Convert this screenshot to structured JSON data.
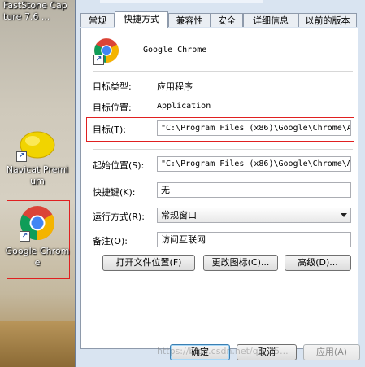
{
  "desktop": {
    "icons": [
      {
        "label": "FastStone Capture 7.6 ..."
      },
      {
        "label": "Navicat Premium"
      },
      {
        "label": "Google Chrome"
      }
    ]
  },
  "dialog": {
    "tabs": [
      {
        "label": "常规"
      },
      {
        "label": "快捷方式"
      },
      {
        "label": "兼容性"
      },
      {
        "label": "安全"
      },
      {
        "label": "详细信息"
      },
      {
        "label": "以前的版本"
      }
    ],
    "app_name": "Google Chrome",
    "target_type_label": "目标类型:",
    "target_type_value": "应用程序",
    "target_location_label": "目标位置:",
    "target_location_value": "Application",
    "target_label": "目标(T):",
    "target_value": "\"C:\\Program Files (x86)\\Google\\Chrome\\A",
    "start_in_label": "起始位置(S):",
    "start_in_value": "\"C:\\Program Files (x86)\\Google\\Chrome\\A",
    "shortcut_key_label": "快捷键(K):",
    "shortcut_key_value": "无",
    "run_label": "运行方式(R):",
    "run_value": "常规窗口",
    "comment_label": "备注(O):",
    "comment_value": "访问互联网",
    "open_location_button": "打开文件位置(F)",
    "change_icon_button": "更改图标(C)...",
    "advanced_button": "高级(D)...",
    "ok_button": "确定",
    "cancel_button": "取消",
    "apply_button": "应用(A)",
    "watermark": "https://blog.csdn.net/qq_35..."
  },
  "colors": {
    "highlight_box": "#e02020",
    "chrome_red": "#db4437",
    "chrome_yellow": "#f4b400",
    "chrome_green": "#0f9d58",
    "chrome_blue": "#4285f4"
  }
}
